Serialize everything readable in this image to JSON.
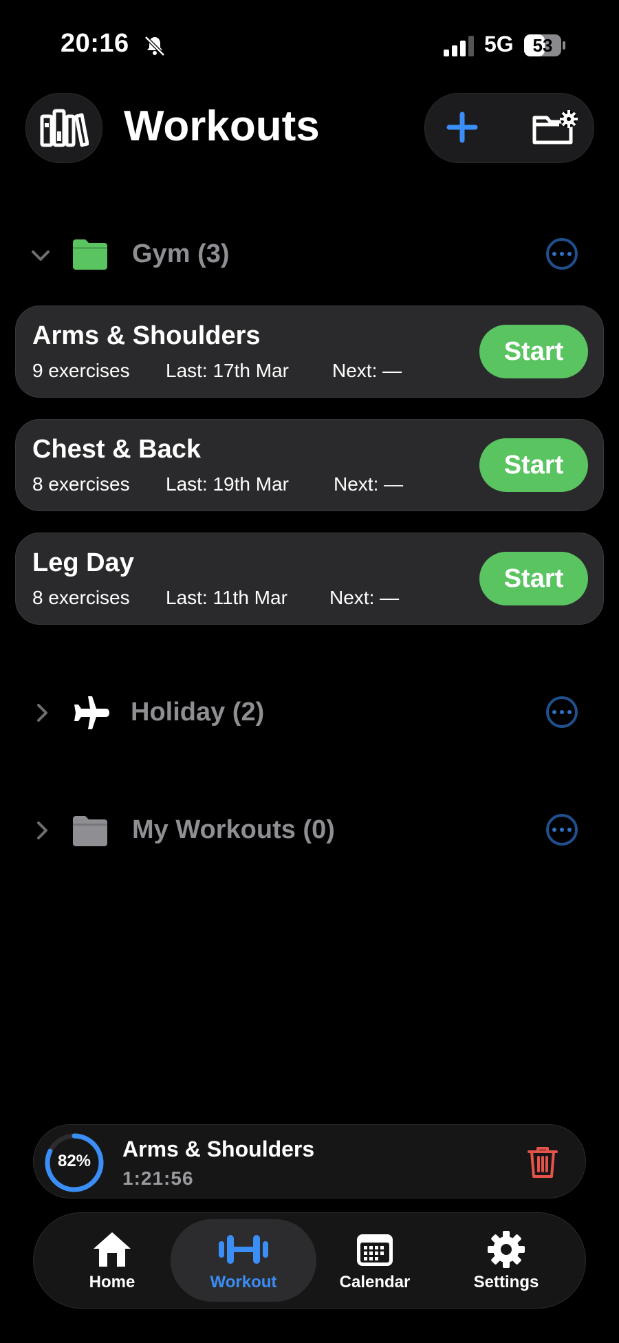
{
  "status_bar": {
    "time": "20:16",
    "network": "5G",
    "battery": "53"
  },
  "header": {
    "title": "Workouts"
  },
  "groups": [
    {
      "label": "Gym (3)",
      "color": "#5ac461",
      "workouts": [
        {
          "title": "Arms & Shoulders",
          "exercises": "9 exercises",
          "last": "Last: 17th Mar",
          "next": "Next: —",
          "action": "Start"
        },
        {
          "title": "Chest & Back",
          "exercises": "8 exercises",
          "last": "Last: 19th Mar",
          "next": "Next: —",
          "action": "Start"
        },
        {
          "title": "Leg Day",
          "exercises": "8 exercises",
          "last": "Last: 11th Mar",
          "next": "Next: —",
          "action": "Start"
        }
      ]
    },
    {
      "label": "Holiday (2)",
      "icon": "airplane-icon"
    },
    {
      "label": "My Workouts (0)",
      "icon": "folder-icon",
      "color": "#8e8e93"
    }
  ],
  "active_session": {
    "title": "Arms & Shoulders",
    "elapsed": "1:21:56",
    "progress_label": "82%",
    "progress": 0.82
  },
  "tabs": [
    {
      "label": "Home",
      "icon": "house-icon"
    },
    {
      "label": "Workout",
      "icon": "dumbbell-icon",
      "active": true
    },
    {
      "label": "Calendar",
      "icon": "calendar-icon"
    },
    {
      "label": "Settings",
      "icon": "gear-icon"
    }
  ],
  "colors": {
    "accent": "#3a8ef6",
    "start": "#5ac461",
    "danger": "#e5534b",
    "more": "#2f73c7"
  }
}
